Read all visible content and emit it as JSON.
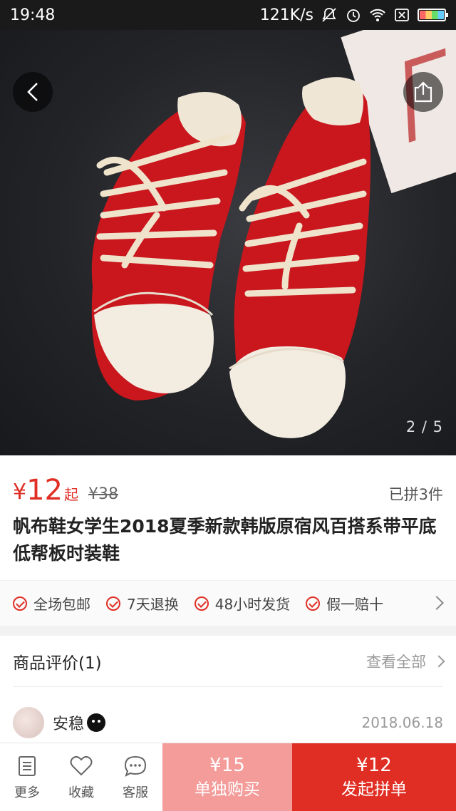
{
  "status_bar": {
    "time": "19:48",
    "network_speed": "121K/s",
    "icons": [
      "mute-icon",
      "alarm-icon",
      "wifi-icon",
      "no-sim-icon",
      "battery-icon"
    ]
  },
  "hero": {
    "image_counter": "2 / 5",
    "back_icon": "back-chevron-icon",
    "share_icon": "share-icon"
  },
  "product": {
    "price_symbol": "¥",
    "price": "12",
    "price_suffix": "起",
    "original_price": "¥38",
    "sold": "已拼3件",
    "title": "帆布鞋女学生2018夏季新款韩版原宿风百搭系带平底低帮板时装鞋"
  },
  "guarantees": [
    "全场包邮",
    "7天退换",
    "48小时发货",
    "假一赔十"
  ],
  "reviews": {
    "title": "商品评价(1)",
    "view_all": "查看全部",
    "first": {
      "name": "安稳",
      "date": "2018.06.18"
    }
  },
  "bottom_bar": {
    "nav": [
      {
        "label": "更多",
        "icon": "more-list-icon"
      },
      {
        "label": "收藏",
        "icon": "heart-icon"
      },
      {
        "label": "客服",
        "icon": "chat-icon"
      }
    ],
    "solo": {
      "price": "¥15",
      "label": "单独购买"
    },
    "group": {
      "price": "¥12",
      "label": "发起拼单"
    }
  },
  "colors": {
    "accent": "#e02e24",
    "solo_button": "#f39c9a"
  }
}
